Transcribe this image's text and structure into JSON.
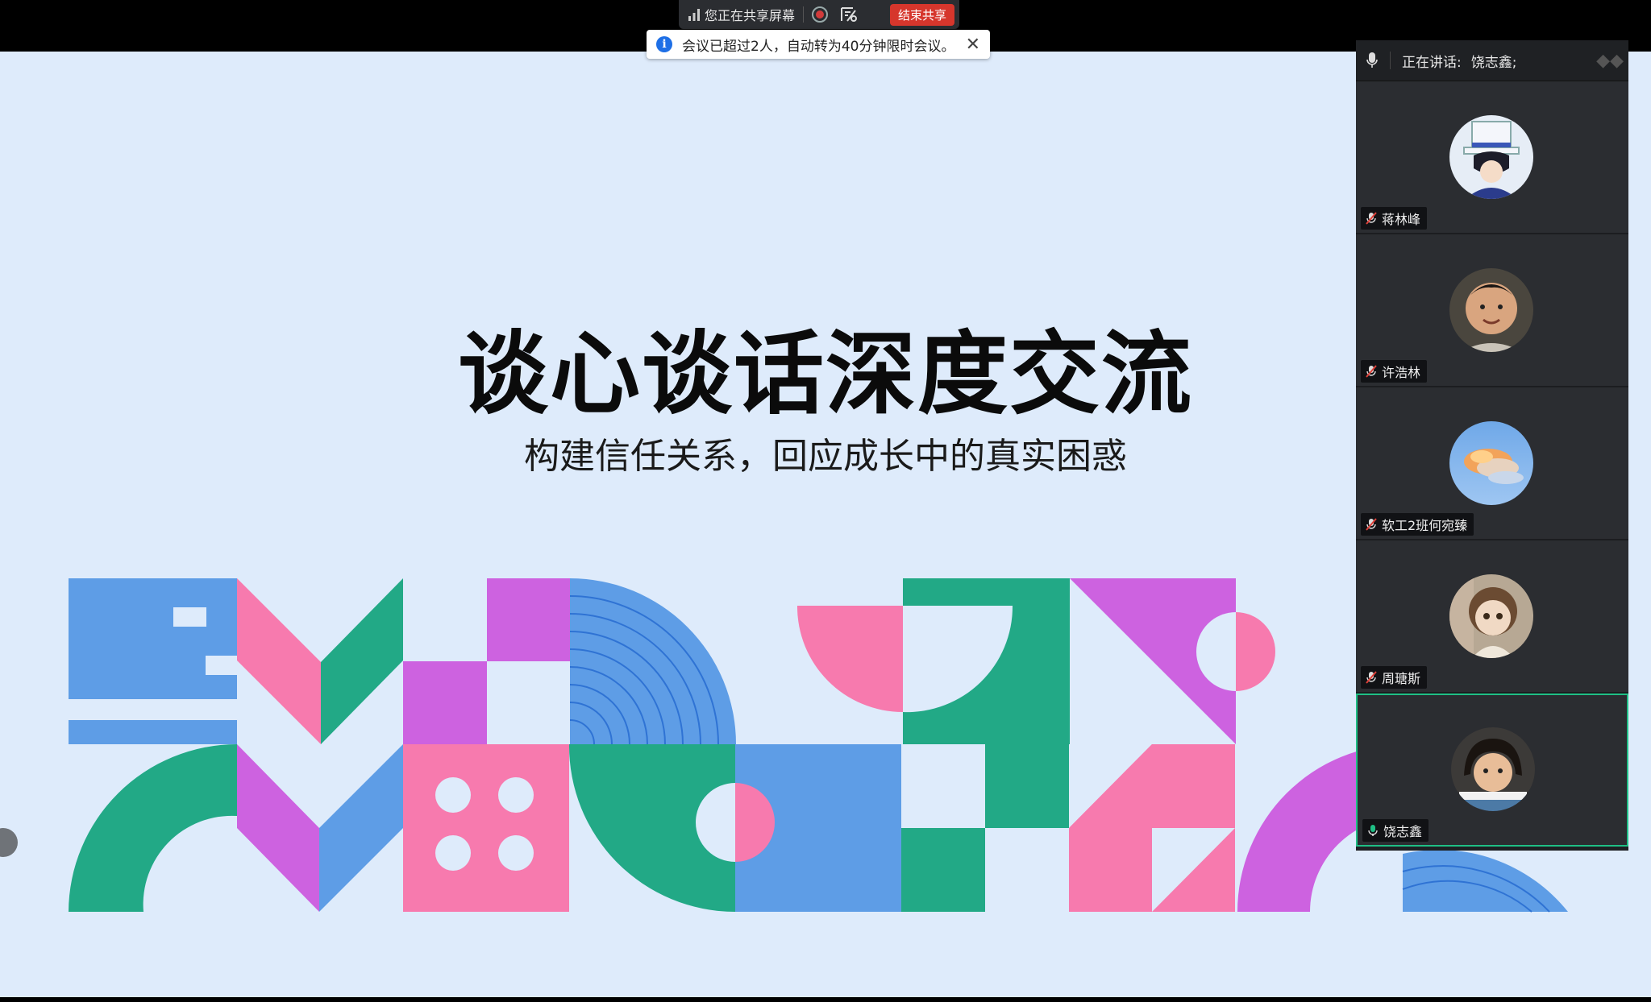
{
  "slide": {
    "title": "谈心谈话深度交流",
    "subtitle": "构建信任关系，回应成长中的真实困惑"
  },
  "share_bar": {
    "status": "您正在共享屏幕",
    "end_label": "结束共享",
    "end_color": "#d6362c"
  },
  "notice": {
    "text": "会议已超过2人，自动转为40分钟限时会议。"
  },
  "speaker": {
    "label": "正在讲话:",
    "name": "饶志鑫;"
  },
  "participants": [
    {
      "name": "蒋林峰",
      "avatar": "top-hat-anime-avatar",
      "mic": "muted"
    },
    {
      "name": "许浩林",
      "avatar": "boy-photo-avatar",
      "mic": "muted"
    },
    {
      "name": "软工2班何宛臻",
      "avatar": "sky-cloud-avatar",
      "mic": "muted"
    },
    {
      "name": "周瑭斯",
      "avatar": "doll-avatar",
      "mic": "muted"
    },
    {
      "name": "饶志鑫",
      "avatar": "child-photo-avatar",
      "mic": "active",
      "active_speaker": true
    }
  ],
  "colors": {
    "blue": "#5e9de6",
    "pink": "#f77aae",
    "purple": "#cd62e0",
    "green": "#22a986",
    "slide_bg": "#deebfb",
    "active_border": "#1fbf85"
  }
}
